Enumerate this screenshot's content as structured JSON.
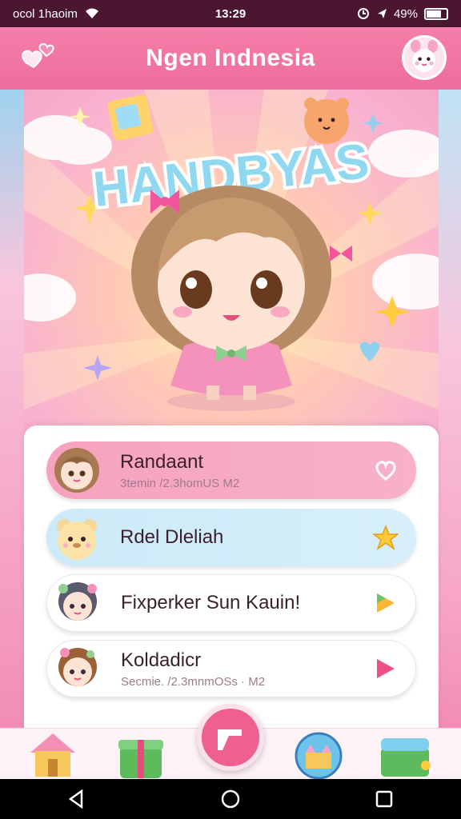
{
  "status": {
    "carrier": "ocol 1haoim",
    "time": "13:29",
    "battery": "49%"
  },
  "header": {
    "title": "Ngen Indnesia"
  },
  "hero": {
    "logo_text": "HANDBYAS"
  },
  "list": [
    {
      "title": "Randaant",
      "subtitle": "3temin /2.3homUS    M2"
    },
    {
      "title": "Rdel Dleliah",
      "subtitle": ""
    },
    {
      "title": "Fixperker Sun Kauin!",
      "subtitle": ""
    },
    {
      "title": "Koldadicr",
      "subtitle": "Secmie. /2.3mnmOSs · M2"
    }
  ],
  "colors": {
    "header": "#ee6d9c",
    "accent": "#ef5f8f",
    "item_pink": "#f6a2bf",
    "item_blue": "#cdeaf8"
  },
  "icons": {
    "header_left": "hearts-icon",
    "header_right": "bunny-avatar-icon",
    "item_1_trail": "heart-outline-icon",
    "item_2_trail": "star-icon",
    "item_3_trail": "play-triangle-icon",
    "item_4_trail": "play-triangle-icon",
    "nav": [
      "house-icon",
      "gift-box-icon",
      "shoe-icon",
      "castle-icon",
      "treasure-chest-icon"
    ]
  }
}
